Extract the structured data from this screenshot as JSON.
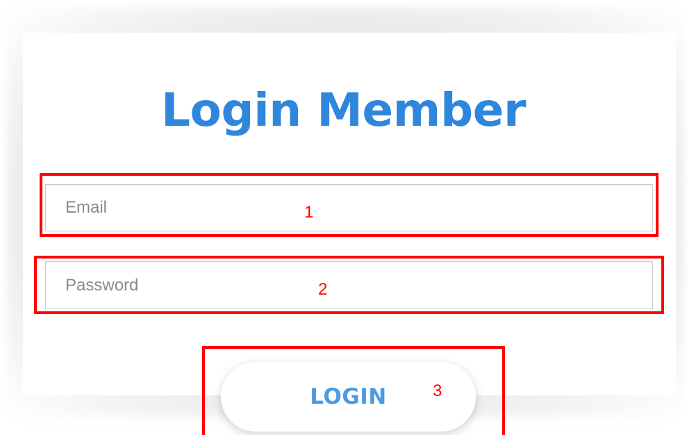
{
  "login_form": {
    "title": "Login Member",
    "email_placeholder": "Email",
    "email_value": "",
    "password_placeholder": "Password",
    "password_value": "",
    "submit_label": "LOGIN"
  },
  "annotations": [
    {
      "label": "1"
    },
    {
      "label": "2"
    },
    {
      "label": "3"
    }
  ],
  "colors": {
    "title": "#2f86dd",
    "button_text": "#4a9be3",
    "annotation": "#ff0000"
  }
}
